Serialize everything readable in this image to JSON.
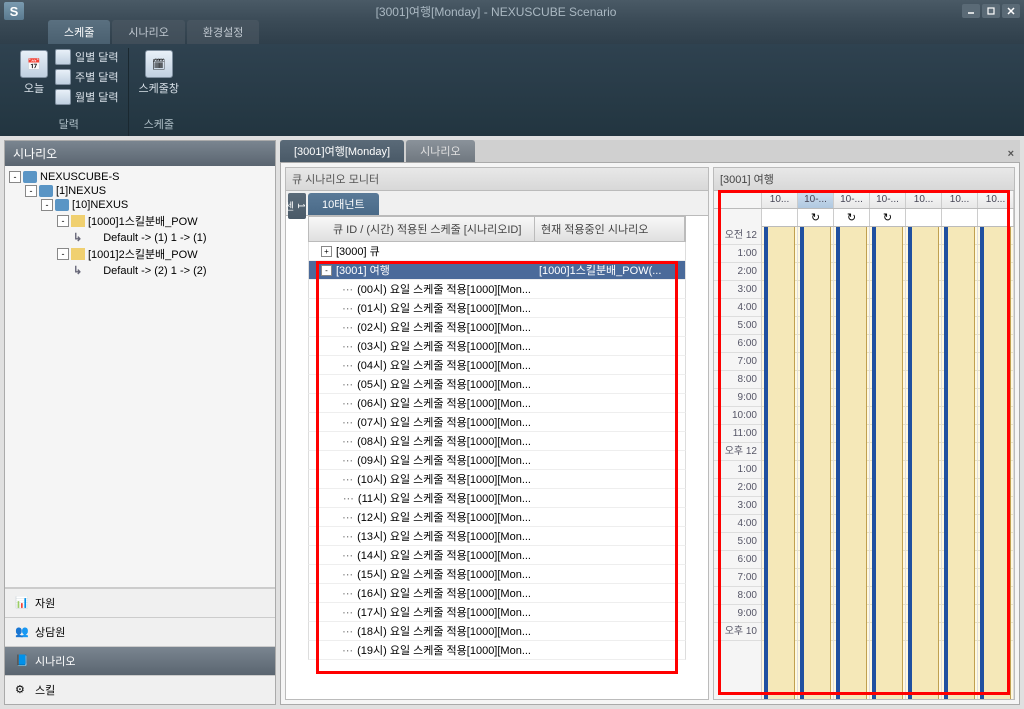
{
  "window": {
    "title": "[3001]여행[Monday] - NEXUSCUBE Scenario",
    "app_letter": "S"
  },
  "ribbon": {
    "tabs": [
      "스케줄",
      "시나리오",
      "환경설정"
    ],
    "groups": [
      {
        "label": "달력",
        "items": [
          {
            "type": "big",
            "label": "오늘"
          },
          {
            "type": "small",
            "label": "일별 달력"
          },
          {
            "type": "small",
            "label": "주별 달력"
          },
          {
            "type": "small",
            "label": "월별 달력"
          }
        ]
      },
      {
        "label": "스케줄",
        "items": [
          {
            "type": "big",
            "label": "스케줄창"
          }
        ]
      }
    ]
  },
  "left_panel": {
    "title": "시나리오",
    "tree": [
      {
        "depth": 0,
        "toggle": "-",
        "icon": "db",
        "label": "NEXUSCUBE-S"
      },
      {
        "depth": 1,
        "toggle": "-",
        "icon": "db",
        "label": "[1]NEXUS"
      },
      {
        "depth": 2,
        "toggle": "-",
        "icon": "db",
        "label": "[10]NEXUS"
      },
      {
        "depth": 3,
        "toggle": "-",
        "icon": "folder",
        "label": "[1000]1스킬분배_POW"
      },
      {
        "depth": 4,
        "toggle": "",
        "icon": "leaf",
        "label": "Default -> (1)  1 -> (1)"
      },
      {
        "depth": 3,
        "toggle": "-",
        "icon": "folder",
        "label": "[1001]2스킬분배_POW"
      },
      {
        "depth": 4,
        "toggle": "",
        "icon": "leaf",
        "label": "Default -> (2)  1 -> (2)"
      }
    ],
    "side_tabs": [
      {
        "label": "자원",
        "icon": "bars"
      },
      {
        "label": "상담원",
        "icon": "people"
      },
      {
        "label": "시나리오",
        "icon": "book",
        "active": true
      },
      {
        "label": "스킬",
        "icon": "skill"
      }
    ]
  },
  "doc_tabs": [
    {
      "label": "[3001]여행[Monday]",
      "active": true
    },
    {
      "label": "시나리오",
      "active": false
    }
  ],
  "monitor": {
    "title": "큐 시나리오 모니터",
    "tenant_side": "1센터",
    "tenant_tab": "10태넌트",
    "columns": [
      "큐 ID / (시간) 적용된 스케줄 [시나리오ID]",
      "현재 적용중인 시나리오"
    ],
    "rows": [
      {
        "indent": 0,
        "toggle": "+",
        "label": "[3000] 큐",
        "val": ""
      },
      {
        "indent": 0,
        "toggle": "-",
        "label": "[3001] 여행",
        "val": "[1000]1스킬분배_POW(...",
        "selected": true
      },
      {
        "indent": 1,
        "label": "(00시) 요일 스케줄 적용[1000][Mon...",
        "val": ""
      },
      {
        "indent": 1,
        "label": "(01시) 요일 스케줄 적용[1000][Mon...",
        "val": ""
      },
      {
        "indent": 1,
        "label": "(02시) 요일 스케줄 적용[1000][Mon...",
        "val": ""
      },
      {
        "indent": 1,
        "label": "(03시) 요일 스케줄 적용[1000][Mon...",
        "val": ""
      },
      {
        "indent": 1,
        "label": "(04시) 요일 스케줄 적용[1000][Mon...",
        "val": ""
      },
      {
        "indent": 1,
        "label": "(05시) 요일 스케줄 적용[1000][Mon...",
        "val": ""
      },
      {
        "indent": 1,
        "label": "(06시) 요일 스케줄 적용[1000][Mon...",
        "val": ""
      },
      {
        "indent": 1,
        "label": "(07시) 요일 스케줄 적용[1000][Mon...",
        "val": ""
      },
      {
        "indent": 1,
        "label": "(08시) 요일 스케줄 적용[1000][Mon...",
        "val": ""
      },
      {
        "indent": 1,
        "label": "(09시) 요일 스케줄 적용[1000][Mon...",
        "val": ""
      },
      {
        "indent": 1,
        "label": "(10시) 요일 스케줄 적용[1000][Mon...",
        "val": ""
      },
      {
        "indent": 1,
        "label": "(11시) 요일 스케줄 적용[1000][Mon...",
        "val": ""
      },
      {
        "indent": 1,
        "label": "(12시) 요일 스케줄 적용[1000][Mon...",
        "val": ""
      },
      {
        "indent": 1,
        "label": "(13시) 요일 스케줄 적용[1000][Mon...",
        "val": ""
      },
      {
        "indent": 1,
        "label": "(14시) 요일 스케줄 적용[1000][Mon...",
        "val": ""
      },
      {
        "indent": 1,
        "label": "(15시) 요일 스케줄 적용[1000][Mon...",
        "val": ""
      },
      {
        "indent": 1,
        "label": "(16시) 요일 스케줄 적용[1000][Mon...",
        "val": ""
      },
      {
        "indent": 1,
        "label": "(17시) 요일 스케줄 적용[1000][Mon...",
        "val": ""
      },
      {
        "indent": 1,
        "label": "(18시) 요일 스케줄 적용[1000][Mon...",
        "val": ""
      },
      {
        "indent": 1,
        "label": "(19시) 요일 스케줄 적용[1000][Mon...",
        "val": ""
      }
    ]
  },
  "schedule": {
    "title": "[3001] 여행",
    "days": [
      "10...",
      "10-...",
      "10-...",
      "10-...",
      "10...",
      "10...",
      "10..."
    ],
    "refresh_days": [
      1,
      2,
      3
    ],
    "hours": [
      "오전 12",
      "1:00",
      "2:00",
      "3:00",
      "4:00",
      "5:00",
      "6:00",
      "7:00",
      "8:00",
      "9:00",
      "10:00",
      "11:00",
      "오후 12",
      "1:00",
      "2:00",
      "3:00",
      "4:00",
      "5:00",
      "6:00",
      "7:00",
      "8:00",
      "9:00",
      "오후 10"
    ],
    "appt_days": [
      0,
      1,
      2,
      3,
      4,
      5,
      6
    ]
  }
}
